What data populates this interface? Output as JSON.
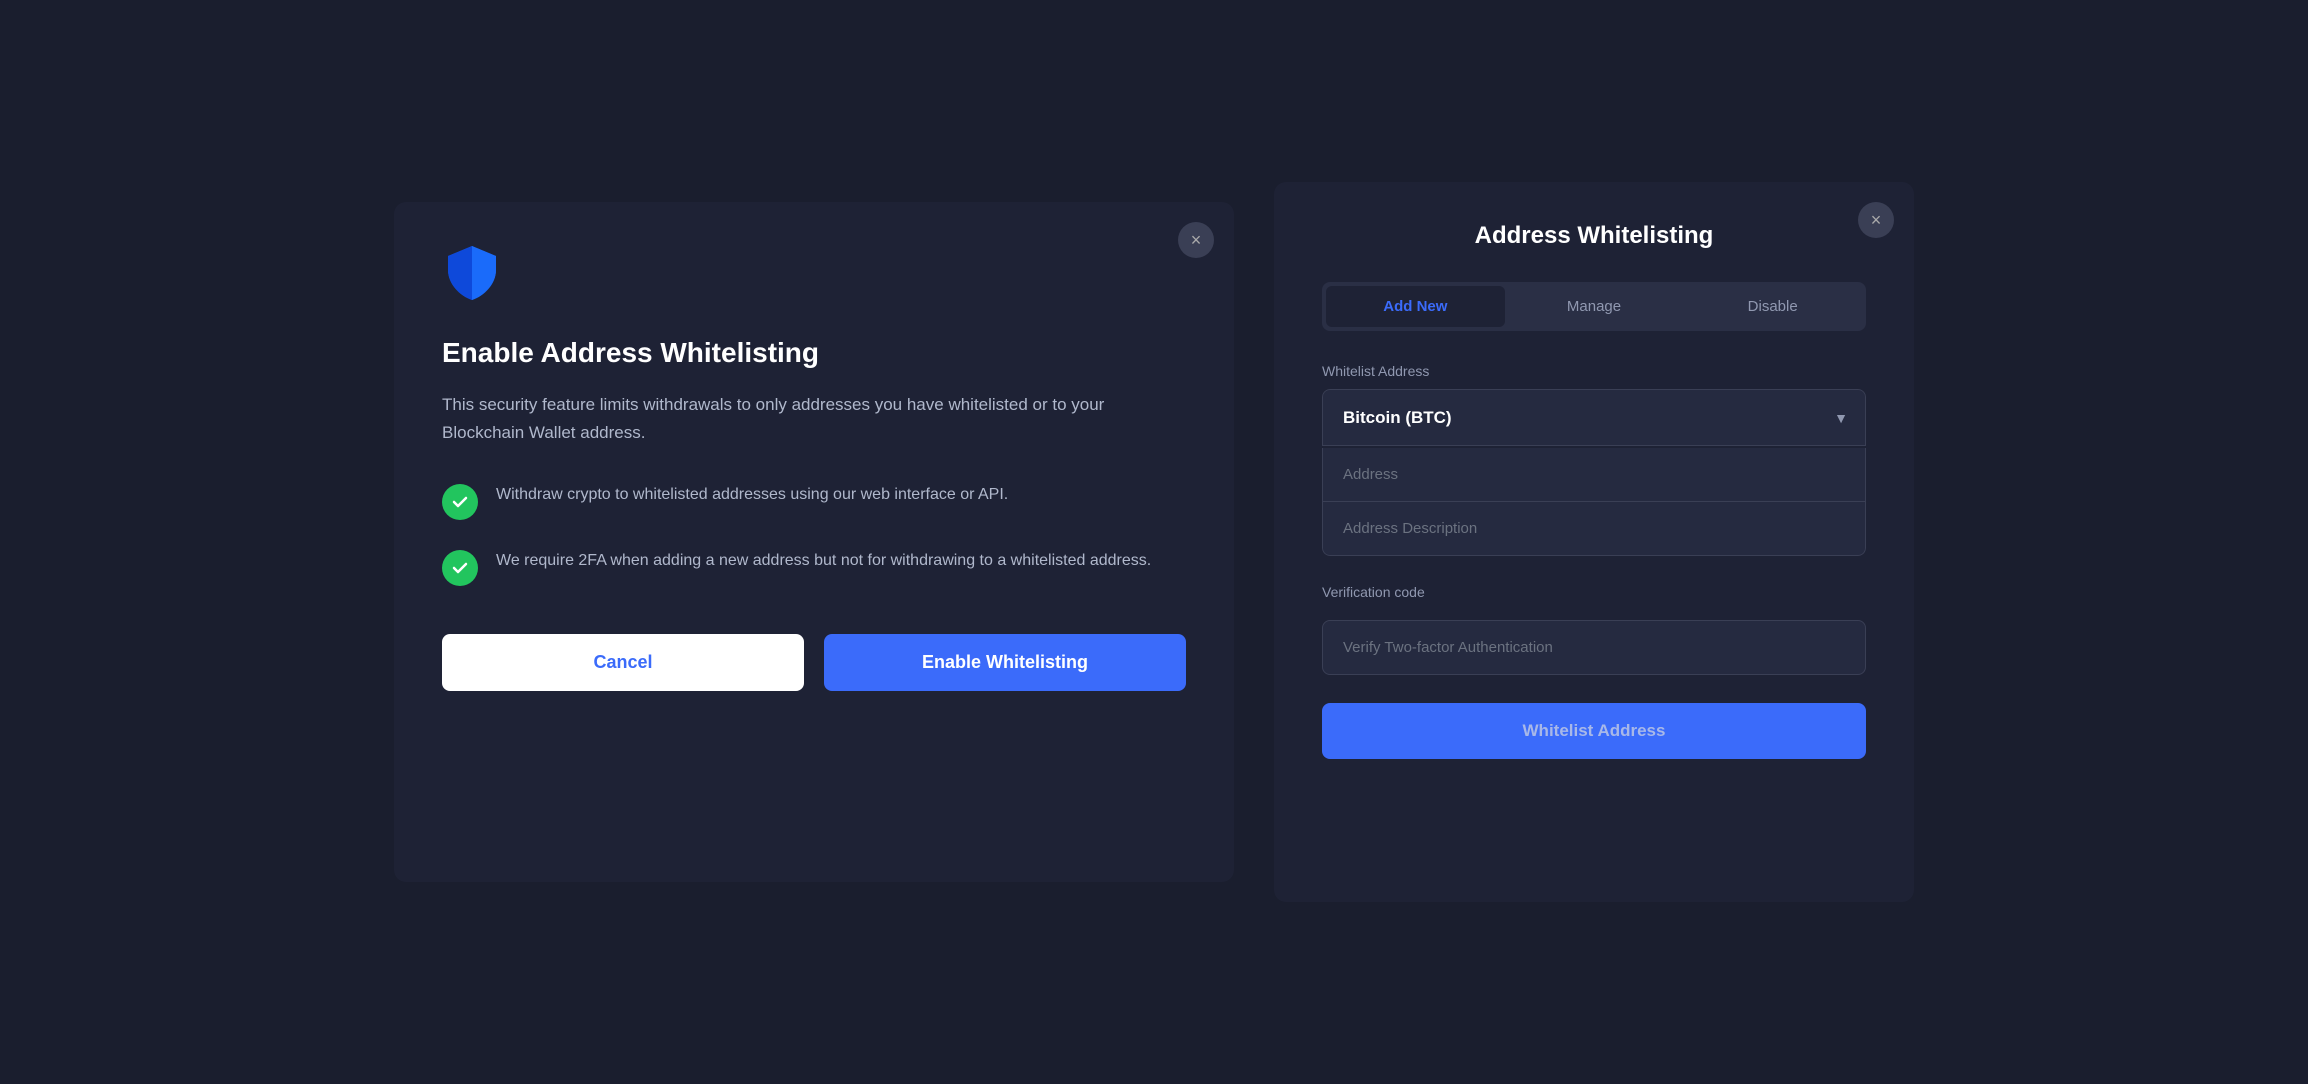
{
  "left_panel": {
    "title": "Enable Address Whitelisting",
    "description": "This security feature limits withdrawals to only addresses you have whitelisted or to your Blockchain Wallet address.",
    "features": [
      {
        "id": "feature-1",
        "text": "Withdraw crypto to whitelisted addresses using our web interface or API."
      },
      {
        "id": "feature-2",
        "text": "We require 2FA when adding a new address but not for withdrawing to a whitelisted address."
      }
    ],
    "cancel_label": "Cancel",
    "enable_label": "Enable Whitelisting",
    "close_label": "×"
  },
  "right_panel": {
    "title": "Address Whitelisting",
    "tabs": [
      {
        "id": "add-new",
        "label": "Add New",
        "active": true
      },
      {
        "id": "manage",
        "label": "Manage",
        "active": false
      },
      {
        "id": "disable",
        "label": "Disable",
        "active": false
      }
    ],
    "whitelist_address_label": "Whitelist Address",
    "crypto_select_value": "Bitcoin (BTC)",
    "address_placeholder": "Address",
    "address_description_placeholder": "Address Description",
    "verification_code_label": "Verification code",
    "verification_placeholder": "Verify Two-factor Authentication",
    "submit_label": "Whitelist Address",
    "close_label": "×"
  },
  "icons": {
    "close": "×",
    "check": "✓",
    "dropdown_arrow": "▼"
  }
}
